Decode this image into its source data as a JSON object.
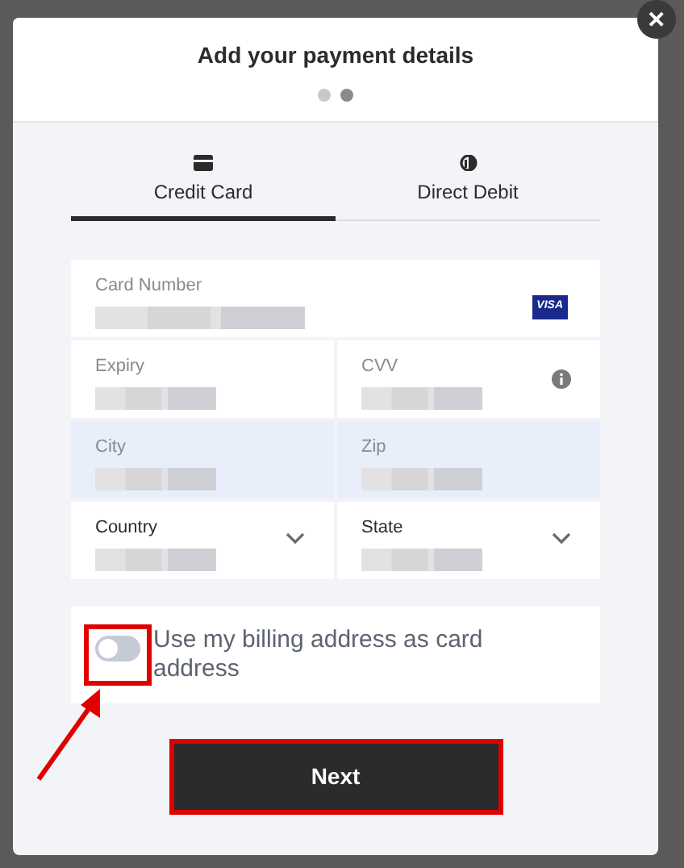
{
  "modal": {
    "title": "Add your payment details",
    "close": "✕",
    "steps": [
      {
        "selected": false
      },
      {
        "selected": true
      }
    ],
    "tabs": [
      {
        "label": "Credit Card",
        "selected": true
      },
      {
        "label": "Direct Debit",
        "selected": false
      }
    ],
    "fields": [
      {
        "label": "Card Number",
        "kind": "card",
        "highlighted": false
      },
      {
        "label": "Expiry",
        "kind": "text",
        "highlighted": false
      },
      {
        "label": "CVV",
        "kind": "info",
        "highlighted": false
      },
      {
        "label": "City",
        "kind": "text",
        "highlighted": true
      },
      {
        "label": "Zip",
        "kind": "text",
        "highlighted": true
      },
      {
        "label": "Country",
        "kind": "select",
        "highlighted": false
      },
      {
        "label": "State",
        "kind": "select",
        "highlighted": false
      }
    ],
    "card_brand": "VISA",
    "billing_toggle": {
      "label": "Use my billing address as card address",
      "on": false,
      "annotated": true
    },
    "next_button": {
      "label": "Next",
      "annotated": true
    }
  }
}
